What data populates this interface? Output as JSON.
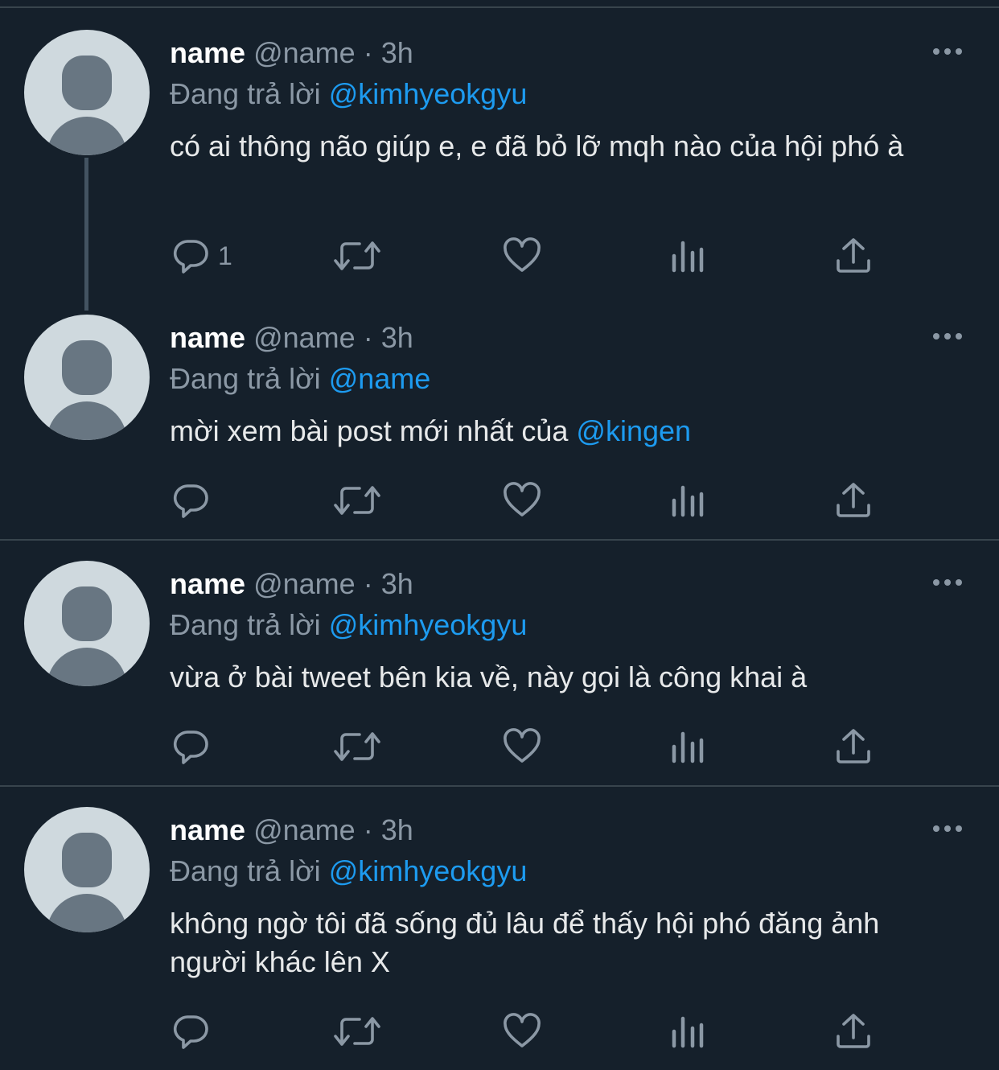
{
  "colors": {
    "background": "#15202b",
    "mention": "#1d9bf0",
    "secondary_text": "#8b98a5",
    "primary_text": "#e7e9ea"
  },
  "icons": [
    "more-icon",
    "reply-icon",
    "retweet-icon",
    "like-icon",
    "views-icon",
    "share-icon"
  ],
  "tweets": [
    {
      "name": "name",
      "handle": "@name",
      "dot": "·",
      "time": "3h",
      "reply_prefix": "Đang trả lời",
      "reply_to": "@kimhyeokgyu",
      "text": "có ai thông não giúp e, e đã bỏ lỡ mqh nào của hội phó à",
      "reply_count": "1"
    },
    {
      "name": "name",
      "handle": "@name",
      "dot": "·",
      "time": "3h",
      "reply_prefix": "Đang trả lời",
      "reply_to": "@name",
      "text": "mời xem bài post mới nhất của ",
      "text_mention": "@kingen"
    },
    {
      "name": "name",
      "handle": "@name",
      "dot": "·",
      "time": "3h",
      "reply_prefix": "Đang trả lời",
      "reply_to": "@kimhyeokgyu",
      "text": "vừa ở bài tweet bên kia về, này gọi là công khai à"
    },
    {
      "name": "name",
      "handle": "@name",
      "dot": "·",
      "time": "3h",
      "reply_prefix": "Đang trả lời",
      "reply_to": "@kimhyeokgyu",
      "text": "không ngờ tôi đã sống đủ lâu để thấy hội phó đăng ảnh người khác lên X"
    }
  ]
}
